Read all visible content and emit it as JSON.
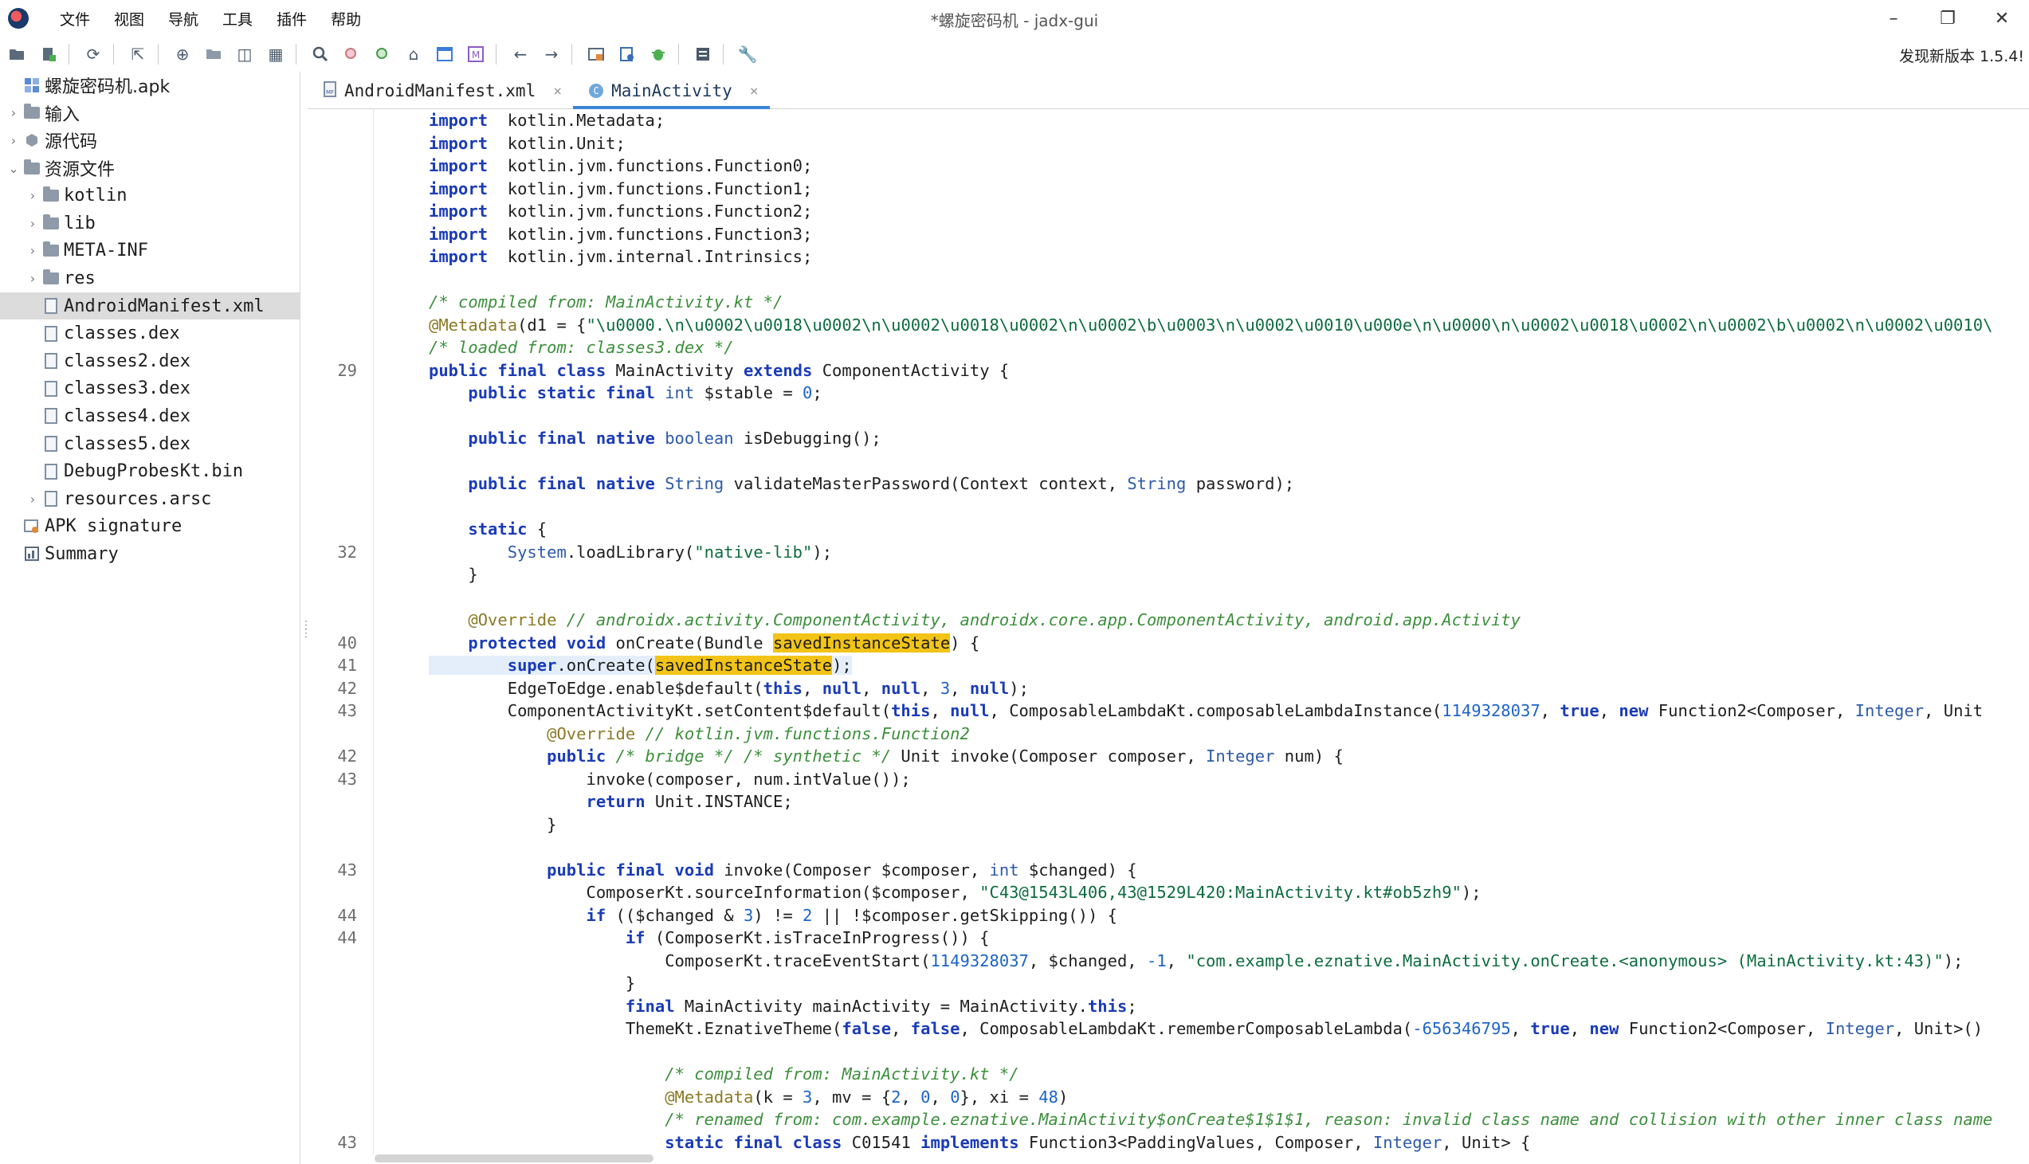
{
  "window": {
    "title": "*螺旋密码机 - jadx-gui",
    "menu": [
      "文件",
      "视图",
      "导航",
      "工具",
      "插件",
      "帮助"
    ],
    "controls": [
      "–",
      "❐",
      "✕"
    ]
  },
  "toolbar": {
    "update_notice": "发现新版本 1.5.4!",
    "icons": [
      "open-file-icon",
      "add-files-icon",
      "sync-icon",
      "export-icon",
      "decompile-all-icon",
      "open-folder-icon",
      "split-view-icon",
      "table-icon",
      "search-icon",
      "find-usage-icon",
      "find-text-icon",
      "home-icon",
      "window-icon",
      "mapping-icon",
      "back-arrow-icon",
      "forward-arrow-icon",
      "tree-icon",
      "bookmark-icon",
      "debug-icon",
      "log-icon",
      "settings-wrench-icon"
    ]
  },
  "tree": {
    "items": [
      {
        "label": "螺旋密码机.apk",
        "level": 0,
        "toggle": "",
        "icon": "apk-icon",
        "cjk": true
      },
      {
        "label": "输入",
        "level": 0,
        "toggle": "›",
        "icon": "input-folder-icon",
        "cjk": true
      },
      {
        "label": "源代码",
        "level": 0,
        "toggle": "›",
        "icon": "package-icon",
        "cjk": true
      },
      {
        "label": "资源文件",
        "level": 0,
        "toggle": "⌄",
        "icon": "resources-folder-icon",
        "cjk": true
      },
      {
        "label": "kotlin",
        "level": 1,
        "toggle": "›",
        "icon": "folder-icon"
      },
      {
        "label": "lib",
        "level": 1,
        "toggle": "›",
        "icon": "folder-icon"
      },
      {
        "label": "META-INF",
        "level": 1,
        "toggle": "›",
        "icon": "folder-icon"
      },
      {
        "label": "res",
        "level": 1,
        "toggle": "›",
        "icon": "folder-icon"
      },
      {
        "label": "AndroidManifest.xml",
        "level": 1,
        "toggle": "",
        "icon": "manifest-file-icon",
        "selected": true
      },
      {
        "label": "classes.dex",
        "level": 1,
        "toggle": "",
        "icon": "dex-file-icon"
      },
      {
        "label": "classes2.dex",
        "level": 1,
        "toggle": "",
        "icon": "dex-file-icon"
      },
      {
        "label": "classes3.dex",
        "level": 1,
        "toggle": "",
        "icon": "dex-file-icon"
      },
      {
        "label": "classes4.dex",
        "level": 1,
        "toggle": "",
        "icon": "dex-file-icon"
      },
      {
        "label": "classes5.dex",
        "level": 1,
        "toggle": "",
        "icon": "dex-file-icon"
      },
      {
        "label": "DebugProbesKt.bin",
        "level": 1,
        "toggle": "",
        "icon": "binary-file-icon"
      },
      {
        "label": "resources.arsc",
        "level": 1,
        "toggle": "›",
        "icon": "arsc-file-icon"
      },
      {
        "label": "APK signature",
        "level": 0,
        "toggle": "",
        "icon": "certificate-icon"
      },
      {
        "label": "Summary",
        "level": 0,
        "toggle": "",
        "icon": "summary-icon"
      }
    ]
  },
  "tabs": [
    {
      "label": "AndroidManifest.xml",
      "icon": "manifest-tab-icon",
      "active": false
    },
    {
      "label": "MainActivity",
      "icon": "class-tab-icon",
      "active": true
    }
  ],
  "code": {
    "lines": [
      {
        "ln": "",
        "segs": [
          [
            "kw",
            "import"
          ],
          [
            "",
            "  kotlin.Metadata;"
          ]
        ]
      },
      {
        "ln": "",
        "segs": [
          [
            "kw",
            "import"
          ],
          [
            "",
            "  kotlin.Unit;"
          ]
        ]
      },
      {
        "ln": "",
        "segs": [
          [
            "kw",
            "import"
          ],
          [
            "",
            "  kotlin.jvm.functions.Function0;"
          ]
        ]
      },
      {
        "ln": "",
        "segs": [
          [
            "kw",
            "import"
          ],
          [
            "",
            "  kotlin.jvm.functions.Function1;"
          ]
        ]
      },
      {
        "ln": "",
        "segs": [
          [
            "kw",
            "import"
          ],
          [
            "",
            "  kotlin.jvm.functions.Function2;"
          ]
        ]
      },
      {
        "ln": "",
        "segs": [
          [
            "kw",
            "import"
          ],
          [
            "",
            "  kotlin.jvm.functions.Function3;"
          ]
        ]
      },
      {
        "ln": "",
        "segs": [
          [
            "kw",
            "import"
          ],
          [
            "",
            "  kotlin.jvm.internal.Intrinsics;"
          ]
        ]
      },
      {
        "ln": "",
        "segs": []
      },
      {
        "ln": "",
        "segs": [
          [
            "cm",
            "/* compiled from: MainActivity.kt */"
          ]
        ]
      },
      {
        "ln": "",
        "segs": [
          [
            "ann",
            "@Metadata"
          ],
          [
            "",
            "(d1 = {"
          ],
          [
            "str",
            "\"\\u0000.\\n\\u0002\\u0018\\u0002\\n\\u0002\\u0018\\u0002\\n\\u0002\\b\\u0003\\n\\u0002\\u0010\\u000e\\n\\u0000\\n\\u0002\\u0018\\u0002\\n\\u0002\\b\\u0002\\n\\u0002\\u0010\\"
          ]
        ]
      },
      {
        "ln": "",
        "segs": [
          [
            "cm",
            "/* loaded from: classes3.dex */"
          ]
        ]
      },
      {
        "ln": "29",
        "segs": [
          [
            "kw",
            "public final class"
          ],
          [
            "",
            " MainActivity "
          ],
          [
            "kw",
            "extends"
          ],
          [
            "",
            " ComponentActivity {"
          ]
        ]
      },
      {
        "ln": "",
        "segs": [
          [
            "",
            "    "
          ],
          [
            "kw",
            "public static final"
          ],
          [
            "",
            " "
          ],
          [
            "ty",
            "int"
          ],
          [
            "",
            " $stable = "
          ],
          [
            "num",
            "0"
          ],
          [
            "",
            ";"
          ]
        ]
      },
      {
        "ln": "",
        "segs": []
      },
      {
        "ln": "",
        "segs": [
          [
            "",
            "    "
          ],
          [
            "kw",
            "public final native"
          ],
          [
            "",
            " "
          ],
          [
            "ty",
            "boolean"
          ],
          [
            "",
            " isDebugging();"
          ]
        ]
      },
      {
        "ln": "",
        "segs": []
      },
      {
        "ln": "",
        "segs": [
          [
            "",
            "    "
          ],
          [
            "kw",
            "public final native"
          ],
          [
            "",
            " "
          ],
          [
            "ty",
            "String"
          ],
          [
            "",
            " validateMasterPassword(Context context, "
          ],
          [
            "ty",
            "String"
          ],
          [
            "",
            " password);"
          ]
        ]
      },
      {
        "ln": "",
        "segs": []
      },
      {
        "ln": "",
        "segs": [
          [
            "",
            "    "
          ],
          [
            "kw",
            "static"
          ],
          [
            "",
            " {"
          ]
        ]
      },
      {
        "ln": "32",
        "segs": [
          [
            "",
            "        "
          ],
          [
            "ty",
            "System"
          ],
          [
            "",
            ".loadLibrary("
          ],
          [
            "str",
            "\"native-lib\""
          ],
          [
            "",
            ");"
          ]
        ]
      },
      {
        "ln": "",
        "segs": [
          [
            "",
            "    }"
          ]
        ]
      },
      {
        "ln": "",
        "segs": []
      },
      {
        "ln": "",
        "segs": [
          [
            "",
            "    "
          ],
          [
            "ann",
            "@Override"
          ],
          [
            "cm",
            " // androidx.activity.ComponentActivity, androidx.core.app.ComponentActivity, android.app.Activity"
          ]
        ]
      },
      {
        "ln": "40",
        "segs": [
          [
            "",
            "    "
          ],
          [
            "kw",
            "protected void"
          ],
          [
            "",
            " onCreate(Bundle "
          ],
          [
            "hl",
            "savedInstanceState"
          ],
          [
            "",
            ") {"
          ]
        ]
      },
      {
        "ln": "41",
        "cur": true,
        "segs": [
          [
            "",
            "        "
          ],
          [
            "kw",
            "super"
          ],
          [
            "",
            ".onCreate("
          ],
          [
            "hl",
            "savedInstanceState"
          ],
          [
            "",
            ");"
          ]
        ]
      },
      {
        "ln": "42",
        "segs": [
          [
            "",
            "        EdgeToEdge.enable$default("
          ],
          [
            "kw",
            "this"
          ],
          [
            "",
            ", "
          ],
          [
            "kw",
            "null"
          ],
          [
            "",
            ", "
          ],
          [
            "kw",
            "null"
          ],
          [
            "",
            ", "
          ],
          [
            "num",
            "3"
          ],
          [
            "",
            ", "
          ],
          [
            "kw",
            "null"
          ],
          [
            "",
            ");"
          ]
        ]
      },
      {
        "ln": "43",
        "segs": [
          [
            "",
            "        ComponentActivityKt.setContent$default("
          ],
          [
            "kw",
            "this"
          ],
          [
            "",
            ", "
          ],
          [
            "kw",
            "null"
          ],
          [
            "",
            ", ComposableLambdaKt.composableLambdaInstance("
          ],
          [
            "num",
            "1149328037"
          ],
          [
            "",
            ", "
          ],
          [
            "kw",
            "true"
          ],
          [
            "",
            ", "
          ],
          [
            "kw",
            "new"
          ],
          [
            "",
            " Function2<Composer, "
          ],
          [
            "ty",
            "Integer"
          ],
          [
            "",
            ", Unit"
          ]
        ]
      },
      {
        "ln": "",
        "segs": [
          [
            "",
            "            "
          ],
          [
            "ann",
            "@Override"
          ],
          [
            "cm",
            " // kotlin.jvm.functions.Function2"
          ]
        ]
      },
      {
        "ln": "42",
        "segs": [
          [
            "",
            "            "
          ],
          [
            "kw",
            "public"
          ],
          [
            "cm",
            " /* bridge */ /* synthetic */"
          ],
          [
            "",
            " Unit invoke(Composer composer, "
          ],
          [
            "ty",
            "Integer"
          ],
          [
            "",
            " num) {"
          ]
        ]
      },
      {
        "ln": "43",
        "segs": [
          [
            "",
            "                invoke(composer, num.intValue());"
          ]
        ]
      },
      {
        "ln": "",
        "segs": [
          [
            "",
            "                "
          ],
          [
            "kw",
            "return"
          ],
          [
            "",
            " Unit.INSTANCE;"
          ]
        ]
      },
      {
        "ln": "",
        "segs": [
          [
            "",
            "            }"
          ]
        ]
      },
      {
        "ln": "",
        "segs": []
      },
      {
        "ln": "43",
        "segs": [
          [
            "",
            "            "
          ],
          [
            "kw",
            "public final void"
          ],
          [
            "",
            " invoke(Composer $composer, "
          ],
          [
            "ty",
            "int"
          ],
          [
            "",
            " $changed) {"
          ]
        ]
      },
      {
        "ln": "",
        "segs": [
          [
            "",
            "                ComposerKt.sourceInformation($composer, "
          ],
          [
            "str",
            "\"C43@1543L406,43@1529L420:MainActivity.kt#ob5zh9\""
          ],
          [
            "",
            ");"
          ]
        ]
      },
      {
        "ln": "44",
        "segs": [
          [
            "",
            "                "
          ],
          [
            "kw",
            "if"
          ],
          [
            "",
            " (($changed & "
          ],
          [
            "num",
            "3"
          ],
          [
            "",
            ") != "
          ],
          [
            "num",
            "2"
          ],
          [
            "",
            " || !$composer.getSkipping()) {"
          ]
        ]
      },
      {
        "ln": "44",
        "segs": [
          [
            "",
            "                    "
          ],
          [
            "kw",
            "if"
          ],
          [
            "",
            " (ComposerKt.isTraceInProgress()) {"
          ]
        ]
      },
      {
        "ln": "",
        "segs": [
          [
            "",
            "                        ComposerKt.traceEventStart("
          ],
          [
            "num",
            "1149328037"
          ],
          [
            "",
            ", $changed, "
          ],
          [
            "num",
            "-1"
          ],
          [
            "",
            ", "
          ],
          [
            "str",
            "\"com.example.eznative.MainActivity.onCreate.<anonymous> (MainActivity.kt:43)\""
          ],
          [
            "",
            ");"
          ]
        ]
      },
      {
        "ln": "",
        "segs": [
          [
            "",
            "                    }"
          ]
        ]
      },
      {
        "ln": "",
        "segs": [
          [
            "",
            "                    "
          ],
          [
            "kw",
            "final"
          ],
          [
            "",
            " MainActivity mainActivity = MainActivity."
          ],
          [
            "kw",
            "this"
          ],
          [
            "",
            ";"
          ]
        ]
      },
      {
        "ln": "",
        "segs": [
          [
            "",
            "                    ThemeKt.EznativeTheme("
          ],
          [
            "kw",
            "false"
          ],
          [
            "",
            ", "
          ],
          [
            "kw",
            "false"
          ],
          [
            "",
            ", ComposableLambdaKt.rememberComposableLambda("
          ],
          [
            "num",
            "-656346795"
          ],
          [
            "",
            ", "
          ],
          [
            "kw",
            "true"
          ],
          [
            "",
            ", "
          ],
          [
            "kw",
            "new"
          ],
          [
            "",
            " Function2<Composer, "
          ],
          [
            "ty",
            "Integer"
          ],
          [
            "",
            ", Unit>()"
          ]
        ]
      },
      {
        "ln": "",
        "segs": []
      },
      {
        "ln": "",
        "segs": [
          [
            "",
            "                        "
          ],
          [
            "cm",
            "/* compiled from: MainActivity.kt */"
          ]
        ]
      },
      {
        "ln": "",
        "segs": [
          [
            "",
            "                        "
          ],
          [
            "ann",
            "@Metadata"
          ],
          [
            "",
            "(k = "
          ],
          [
            "num",
            "3"
          ],
          [
            "",
            ", mv = {"
          ],
          [
            "num",
            "2"
          ],
          [
            "",
            ", "
          ],
          [
            "num",
            "0"
          ],
          [
            "",
            ", "
          ],
          [
            "num",
            "0"
          ],
          [
            "",
            "}, xi = "
          ],
          [
            "num",
            "48"
          ],
          [
            "",
            ")"
          ]
        ]
      },
      {
        "ln": "",
        "segs": [
          [
            "",
            "                        "
          ],
          [
            "cm",
            "/* renamed from: com.example.eznative.MainActivity$onCreate$1$1$1, reason: invalid class name and collision with other inner class name"
          ]
        ]
      },
      {
        "ln": "43",
        "segs": [
          [
            "",
            "                        "
          ],
          [
            "kw",
            "static final class"
          ],
          [
            "",
            " C01541 "
          ],
          [
            "kw",
            "implements"
          ],
          [
            "",
            " Function3<PaddingValues, Composer, "
          ],
          [
            "ty",
            "Integer"
          ],
          [
            "",
            ", Unit> {"
          ]
        ]
      }
    ]
  }
}
